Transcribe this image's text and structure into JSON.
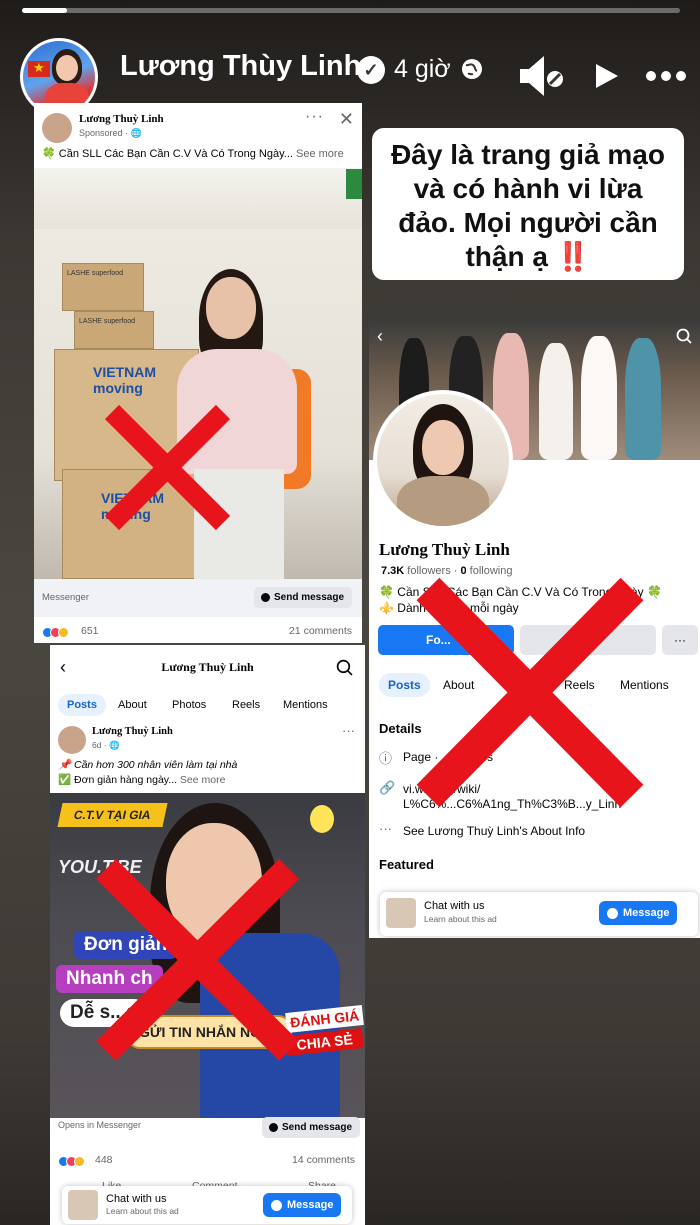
{
  "story": {
    "author": "Lương Thùy Linh",
    "time": "4 giờ",
    "warning_lines": [
      "Đây là trang giả mạo",
      "và có hành vi lừa",
      "đảo. Mọi người cần",
      "thận ạ"
    ],
    "warning_emoji": "‼️"
  },
  "ad1": {
    "page_name": "Lương Thuỳ Linh",
    "sponsored": "Sponsored · ",
    "text": "🍀 Cần SLL Các Bạn Cần C.V Và Có Trong Ngày...",
    "see_more": " See more",
    "messenger": "Messenger",
    "send": "Send message",
    "reactions": "651",
    "comments": "21 comments",
    "boxes": [
      "LASHE superfood",
      "LASHE superfood",
      "VIETNAM moving",
      "VIETNAM moving"
    ]
  },
  "profile": {
    "name": "Lương Thuỳ Linh",
    "followers_count": "7.3K",
    "followers_label": " followers",
    "following_count": "0",
    "following_label": " following",
    "bio1": "🍀 Cần SLL Các Bạn Cần C.V Và Có Trong Ngày 🍀",
    "bio2": "⚜️ Dành ... 2-4h mỗi ngày",
    "tabs": [
      "Posts",
      "About",
      "Reels",
      "Mentions"
    ],
    "details": "Details",
    "page_row": "Page · ... nesses",
    "link1": "vi.wi...org/wiki/",
    "link2": "L%C6%...C6%A1ng_Th%C3%B...y_Linh",
    "about_row": "See Lương Thuỳ Linh's About Info",
    "featured": "Featured",
    "chat_title": "Chat with us",
    "chat_sub": "Learn about this ad",
    "message": "Message",
    "follow_btn": "Fo...",
    "more_btn": "···"
  },
  "post": {
    "title": "Lương Thuỳ Linh",
    "tabs": [
      "Posts",
      "About",
      "Photos",
      "Reels",
      "Mentions"
    ],
    "author": "Lương Thuỳ Linh",
    "meta": "6d · ",
    "line1": "📌 Cần hơn 300 nhân viên làm tại nhà",
    "line2": "✅ Đơn giản hàng ngày...",
    "see_more": " See more",
    "ctv": "C.T.V TẠI GIA",
    "youtube": "YOU.T.BE",
    "p1": "Đơn giản",
    "p2": "Nhanh ch",
    "p3": "Dễ s...g",
    "gui": "GỬI TIN NHẮN NGAY",
    "danh": "ĐÁNH GIÁ",
    "chia": "CHIA SẺ",
    "opens": "Opens in Messenger",
    "send": "Send message",
    "reactions": "448",
    "comments": "14 comments",
    "like": "Like",
    "comment": "Comment",
    "share": "Share",
    "chat_title": "Chat with us",
    "chat_sub": "Learn about this ad",
    "message": "Message"
  },
  "colors": {
    "x_red": "#e8141c",
    "fb_blue": "#1877f2"
  }
}
